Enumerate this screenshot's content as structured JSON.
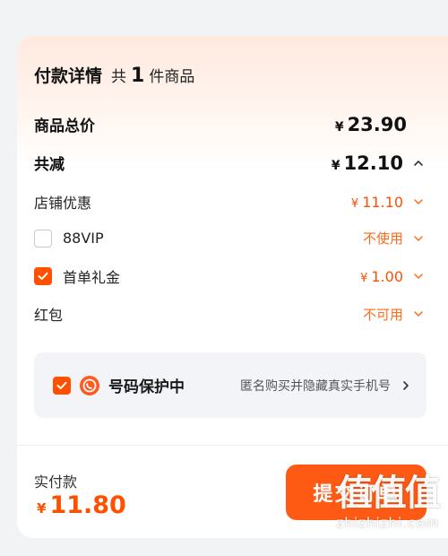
{
  "header": {
    "title": "付款详情",
    "count_prefix": "共",
    "count": "1",
    "count_suffix": "件商品"
  },
  "rows": {
    "subtotal": {
      "label": "商品总价",
      "currency": "¥",
      "amount": "23.90"
    },
    "total_discount": {
      "label": "共减",
      "currency": "¥",
      "amount": "12.10",
      "expanded": true
    },
    "store_discount": {
      "label": "店铺优惠",
      "currency": "¥",
      "amount": "11.10"
    },
    "vip": {
      "label": "88VIP",
      "checked": false,
      "value": "不使用"
    },
    "first_order_gift": {
      "label": "首单礼金",
      "checked": true,
      "currency": "¥",
      "amount": "1.00"
    },
    "red_packet": {
      "label": "红包",
      "value": "不可用"
    }
  },
  "number_protection": {
    "checked": true,
    "title": "号码保护中",
    "description": "匿名购买并隐藏真实手机号"
  },
  "footer": {
    "pay_label": "实付款",
    "currency": "¥",
    "pay_amount": "11.80",
    "submit_label": "提交订单"
  },
  "watermark": {
    "logo": "值值值",
    "url": "zhizhizhi.com"
  },
  "colors": {
    "accent": "#ff5000",
    "muted_accent": "#ff6a1a",
    "card_bg": "#ffffff",
    "page_bg": "#f2f3f5",
    "protect_bg": "#f2f4f7"
  }
}
